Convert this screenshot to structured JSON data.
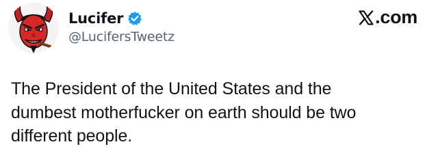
{
  "tweet": {
    "author": {
      "display_name": "Lucifer",
      "handle": "@LucifersTweetz",
      "verified": true,
      "avatar_icon": "devil-avatar-icon",
      "verified_icon": "verified-badge-icon"
    },
    "source": {
      "label": ".com",
      "logo_icon": "x-logo-icon"
    },
    "text": "The President of the United States and the\ndumbest motherfucker on earth should be two\ndifferent people."
  },
  "colors": {
    "text": "#0f1419",
    "secondary_text": "#536471",
    "verified_blue": "#1d9bf0",
    "avatar_red": "#d62828"
  }
}
